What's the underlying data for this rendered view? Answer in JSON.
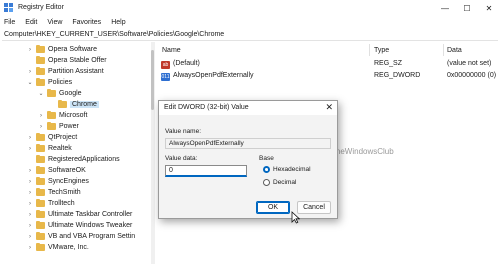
{
  "window": {
    "title": "Registry Editor",
    "minimize_glyph": "—",
    "maximize_glyph": "☐",
    "close_glyph": "✕"
  },
  "menu": [
    "File",
    "Edit",
    "View",
    "Favorites",
    "Help"
  ],
  "address": "Computer\\HKEY_CURRENT_USER\\Software\\Policies\\Google\\Chrome",
  "tree": [
    {
      "label": "Opera Software",
      "chevron": "›",
      "indent": 1,
      "selected": false
    },
    {
      "label": "Opera Stable Offer",
      "chevron": "",
      "indent": 1,
      "selected": false
    },
    {
      "label": "Partition Assistant",
      "chevron": "›",
      "indent": 1,
      "selected": false
    },
    {
      "label": "Policies",
      "chevron": "⌄",
      "indent": 1,
      "selected": false
    },
    {
      "label": "Google",
      "chevron": "⌄",
      "indent": 2,
      "selected": false
    },
    {
      "label": "Chrome",
      "chevron": "",
      "indent": 3,
      "selected": true
    },
    {
      "label": "Microsoft",
      "chevron": "›",
      "indent": 2,
      "selected": false
    },
    {
      "label": "Power",
      "chevron": "›",
      "indent": 2,
      "selected": false
    },
    {
      "label": "QtProject",
      "chevron": "›",
      "indent": 1,
      "selected": false
    },
    {
      "label": "Realtek",
      "chevron": "›",
      "indent": 1,
      "selected": false
    },
    {
      "label": "RegisteredApplications",
      "chevron": "",
      "indent": 1,
      "selected": false
    },
    {
      "label": "SoftwareOK",
      "chevron": "›",
      "indent": 1,
      "selected": false
    },
    {
      "label": "SyncEngines",
      "chevron": "›",
      "indent": 1,
      "selected": false
    },
    {
      "label": "TechSmith",
      "chevron": "›",
      "indent": 1,
      "selected": false
    },
    {
      "label": "Trolltech",
      "chevron": "›",
      "indent": 1,
      "selected": false
    },
    {
      "label": "Ultimate Taskbar Controller",
      "chevron": "›",
      "indent": 1,
      "selected": false
    },
    {
      "label": "Ultimate Windows Tweaker",
      "chevron": "›",
      "indent": 1,
      "selected": false
    },
    {
      "label": "VB and VBA Program Settin",
      "chevron": "›",
      "indent": 1,
      "selected": false
    },
    {
      "label": "VMware, Inc.",
      "chevron": "›",
      "indent": 1,
      "selected": false
    }
  ],
  "columns": {
    "name": "Name",
    "type": "Type",
    "data": "Data"
  },
  "values": [
    {
      "icon": "ab",
      "icon_color": "#c0392b",
      "name": "(Default)",
      "type": "REG_SZ",
      "data": "(value not set)"
    },
    {
      "icon": "011",
      "icon_color": "#2e6fd1",
      "name": "AlwaysOpenPdfExternally",
      "type": "REG_DWORD",
      "data": "0x00000000 (0)"
    }
  ],
  "dialog": {
    "title": "Edit DWORD (32-bit) Value",
    "close_glyph": "✕",
    "value_name_label": "Value name:",
    "value_name": "AlwaysOpenPdfExternally",
    "value_data_label": "Value data:",
    "value_data": "0",
    "base_label": "Base",
    "radio_hex": "Hexadecimal",
    "radio_dec": "Decimal",
    "selected_base": "Hexadecimal",
    "ok": "OK",
    "cancel": "Cancel"
  },
  "watermark": "TheWindowsClub",
  "colors": {
    "accent": "#0067c0",
    "folder": "#e8b84a",
    "selection": "#cce4f7"
  }
}
